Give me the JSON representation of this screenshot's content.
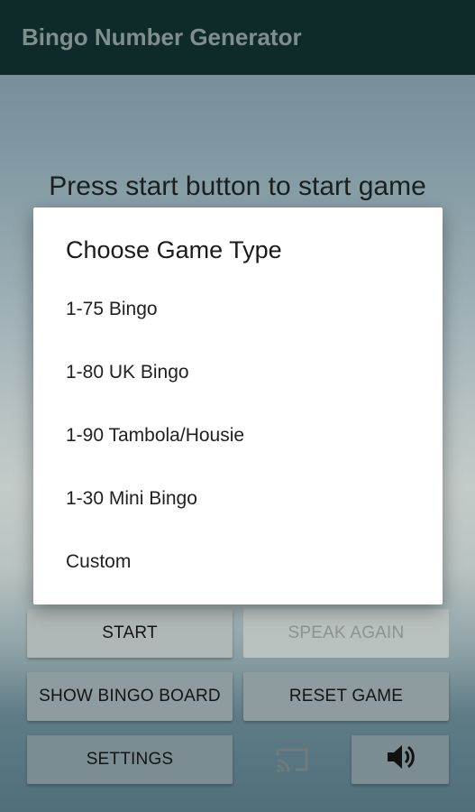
{
  "appbar": {
    "title": "Bingo Number Generator"
  },
  "main": {
    "status_text": "Press start button to start game"
  },
  "dialog": {
    "title": "Choose Game Type",
    "options": [
      {
        "label": "1-75 Bingo"
      },
      {
        "label": "1-80 UK Bingo"
      },
      {
        "label": "1-90 Tambola/Housie"
      },
      {
        "label": "1-30 Mini Bingo"
      },
      {
        "label": "Custom"
      }
    ]
  },
  "buttons": {
    "start": "START",
    "speak_again": "SPEAK AGAIN",
    "show_board": "SHOW BINGO BOARD",
    "reset": "RESET GAME",
    "settings": "SETTINGS"
  },
  "icons": {
    "cast": "cast-icon",
    "sound": "volume-up-icon"
  },
  "colors": {
    "appbar": "#0f2b29",
    "dialog_bg": "#ffffff"
  }
}
